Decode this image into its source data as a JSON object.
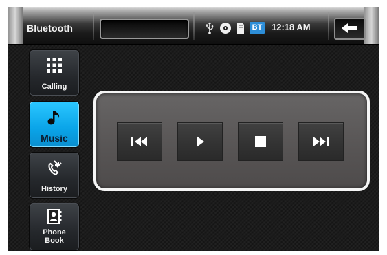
{
  "status_bar": {
    "title": "Bluetooth",
    "bt_badge": "BT",
    "time": "12:18 AM",
    "icons": [
      "usb-icon",
      "disc-icon",
      "sd-card-icon",
      "back-arrow-icon"
    ]
  },
  "sidebar": {
    "items": [
      {
        "id": "calling",
        "label": "Calling",
        "icon": "keypad-icon",
        "active": false
      },
      {
        "id": "music",
        "label": "Music",
        "icon": "music-note-icon",
        "active": true
      },
      {
        "id": "history",
        "label": "History",
        "icon": "call-history-icon",
        "active": false
      },
      {
        "id": "phonebook",
        "label_line1": "Phone",
        "label_line2": "Book",
        "icon": "contact-card-icon",
        "active": false
      }
    ]
  },
  "player": {
    "controls": [
      "previous-icon",
      "play-icon",
      "stop-icon",
      "next-icon"
    ]
  },
  "colors": {
    "active_accent": "#1ab4f5",
    "bt_badge": "#2d8ed8",
    "panel": "#5e5b5b"
  }
}
